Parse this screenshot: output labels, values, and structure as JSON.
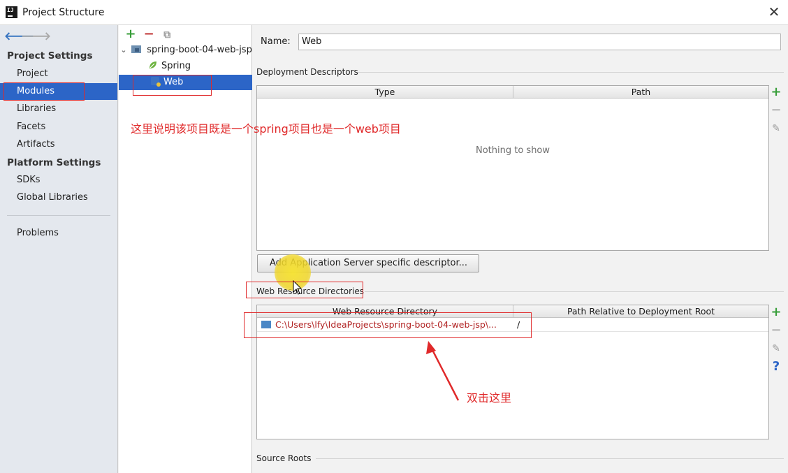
{
  "window": {
    "title": "Project Structure",
    "app_icon_text": "IJ",
    "close_glyph": "✕"
  },
  "sidebar": {
    "nav_back": "🡐",
    "nav_forward": "🡒",
    "project_settings_title": "Project Settings",
    "project_settings_items": [
      "Project",
      "Modules",
      "Libraries",
      "Facets",
      "Artifacts"
    ],
    "platform_settings_title": "Platform Settings",
    "platform_settings_items": [
      "SDKs",
      "Global Libraries"
    ],
    "other_items": [
      "Problems"
    ],
    "selected_item": "Modules"
  },
  "modules_tree": {
    "toolbar": {
      "add": "+",
      "remove": "−",
      "copy": "⧉"
    },
    "root": "spring-boot-04-web-jsp",
    "children": [
      "Spring",
      "Web"
    ],
    "selected": "Web"
  },
  "facet_editor": {
    "name_label": "Name:",
    "name_value": "Web",
    "deployment_descriptors_title": "Deployment Descriptors",
    "descriptor_columns": [
      "Type",
      "Path"
    ],
    "descriptor_empty": "Nothing to show",
    "add_descriptor_button": "Add Application Server specific descriptor...",
    "web_resource_title": "Web Resource Directories",
    "web_resource_columns": [
      "Web Resource Directory",
      "Path Relative to Deployment Root"
    ],
    "web_resource_rows": [
      {
        "directory": "C:\\Users\\lfy\\IdeaProjects\\spring-boot-04-web-jsp\\...",
        "path": "/"
      }
    ],
    "source_roots_title": "Source Roots",
    "side_tools": {
      "add": "+",
      "remove": "−",
      "edit": "✎",
      "help": "?"
    }
  },
  "annotations": {
    "explain_text": "这里说明该项目既是一个spring项目也是一个web项目",
    "double_click_text": "双击这里",
    "color": "#e0292a"
  },
  "colors": {
    "selection": "#2c65c7",
    "sidebar_bg": "#e4e8ee",
    "add_green": "#389e3a",
    "remove_red": "#c23a3a",
    "highlight": "#f3dc2a"
  }
}
